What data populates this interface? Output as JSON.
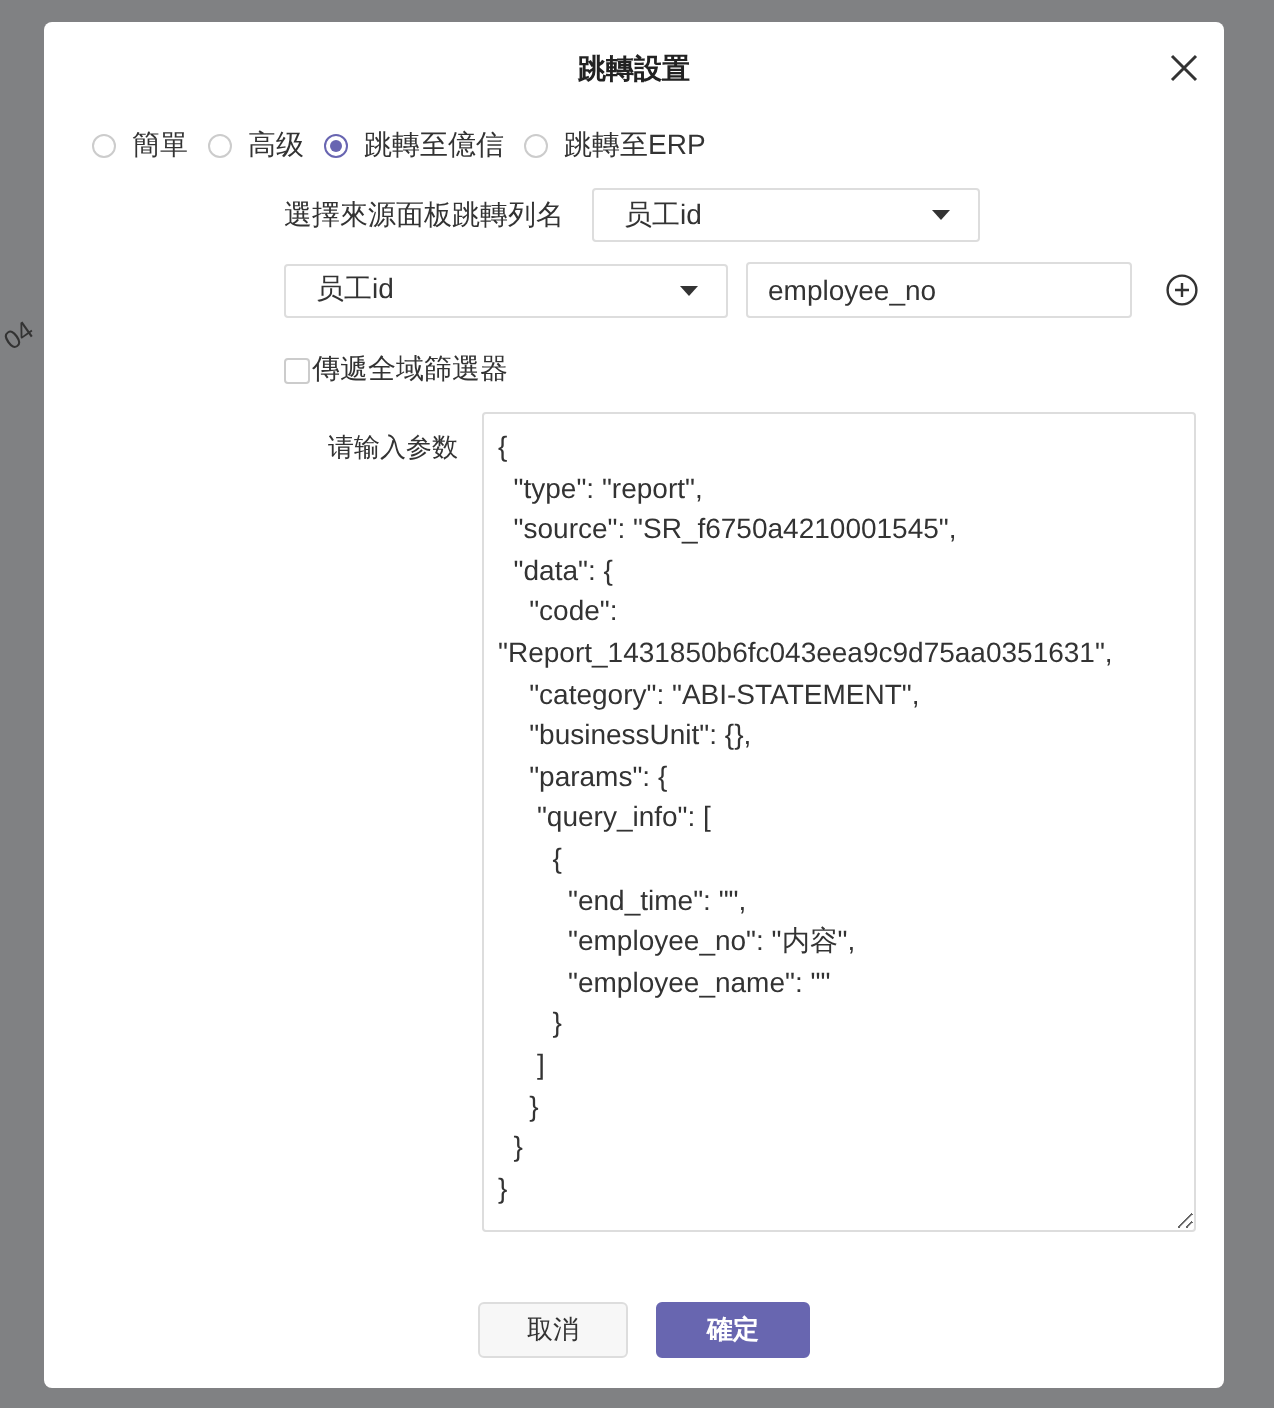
{
  "background": {
    "fragment": "04"
  },
  "dialog": {
    "title": "跳轉設置",
    "modes": [
      {
        "label": "簡單",
        "selected": false
      },
      {
        "label": "高级",
        "selected": false
      },
      {
        "label": "跳轉至億信",
        "selected": true
      },
      {
        "label": "跳轉至ERP",
        "selected": false
      }
    ],
    "source_column": {
      "label": "選擇來源面板跳轉列名",
      "value": "员工id"
    },
    "mapping": {
      "field": "员工id",
      "param": "employee_no"
    },
    "pass_global_filter": {
      "label": "傳遞全域篩選器",
      "checked": false
    },
    "params": {
      "label": "请输入参数",
      "value": "{\n  \"type\": \"report\",\n  \"source\": \"SR_f6750a4210001545\",\n  \"data\": {\n    \"code\": \"Report_1431850b6fc043eea9c9d75aa0351631\",\n    \"category\": \"ABI-STATEMENT\",\n    \"businessUnit\": {},\n    \"params\": {\n     \"query_info\": [\n       {\n         \"end_time\": \"\",\n         \"employee_no\": \"内容\",\n         \"employee_name\": \"\"\n       }\n     ]\n    }\n  }\n}"
    },
    "buttons": [
      {
        "label": "取消",
        "kind": "secondary"
      },
      {
        "label": "確定",
        "kind": "primary"
      }
    ]
  }
}
